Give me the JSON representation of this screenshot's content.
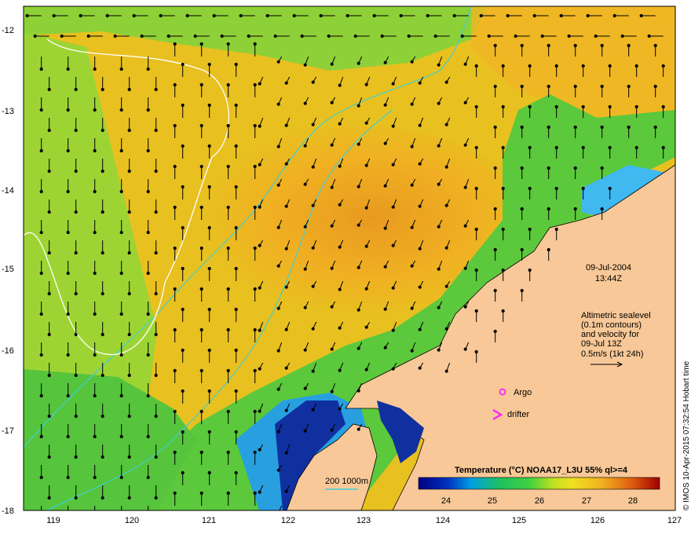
{
  "map": {
    "x_ticks": [
      "119",
      "120",
      "121",
      "122",
      "123",
      "124",
      "125",
      "126",
      "127"
    ],
    "y_ticks": [
      "-12",
      "-13",
      "-14",
      "-15",
      "-16",
      "-17",
      "-18"
    ],
    "date": "09-Jul-2004",
    "time": "13:44Z",
    "info_lines": [
      "Altimetric sealevel",
      "(0.1m contours)",
      "and velocity for",
      "09-Jul 13Z",
      "0.5m/s (1kt 24h)"
    ],
    "legend_argo": "Argo",
    "legend_drifter": "drifter",
    "bathy_legend": "200  1000m",
    "colorbar_title": "Temperature (°C) NOAA17_L3U 55% ql>=4",
    "colorbar_ticks": [
      "24",
      "25",
      "26",
      "27",
      "28"
    ],
    "credit": "© IMOS 10-Apr-2015 07:32:54 Hobart time",
    "colors": {
      "land": "#f8c898",
      "sst_warm": "#f0a020",
      "sst_mid": "#e8c818",
      "sst_cool": "#40c040",
      "sst_cold": "#1030a0",
      "contour": "#ffffff",
      "bathy": "#40d0d0",
      "marker": "#ff20ff"
    }
  }
}
